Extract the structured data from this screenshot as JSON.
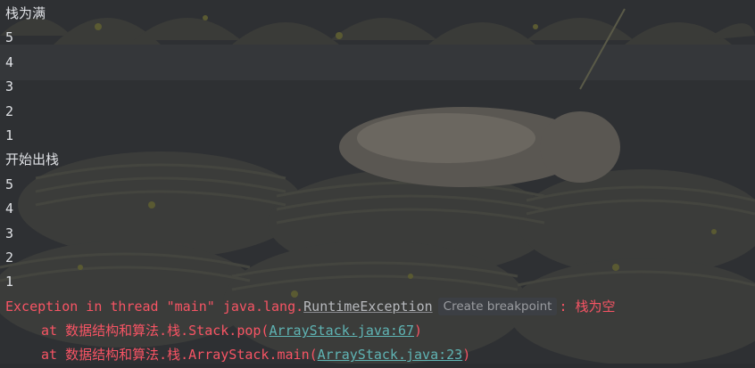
{
  "console": {
    "lines": [
      "栈为满",
      "5",
      "4",
      "3",
      "2",
      "1",
      "开始出栈",
      "5",
      "4",
      "3",
      "2",
      "1"
    ],
    "exception": {
      "prefix": "Exception in thread \"main\" java.lang.",
      "class_link": "RuntimeException",
      "breakpoint_label": "Create breakpoint",
      "suffix": ": 栈为空"
    },
    "stack_trace": [
      {
        "prefix": "at 数据结构和算法.栈.Stack.pop(",
        "link": "ArrayStack.java:67",
        "suffix": ")"
      },
      {
        "prefix": "at 数据结构和算法.栈.ArrayStack.main(",
        "link": "ArrayStack.java:23",
        "suffix": ")"
      }
    ]
  },
  "colors": {
    "background": "#2b2d30",
    "text": "#dfe1e5",
    "error": "#f75464",
    "link": "#5fb4b4"
  }
}
